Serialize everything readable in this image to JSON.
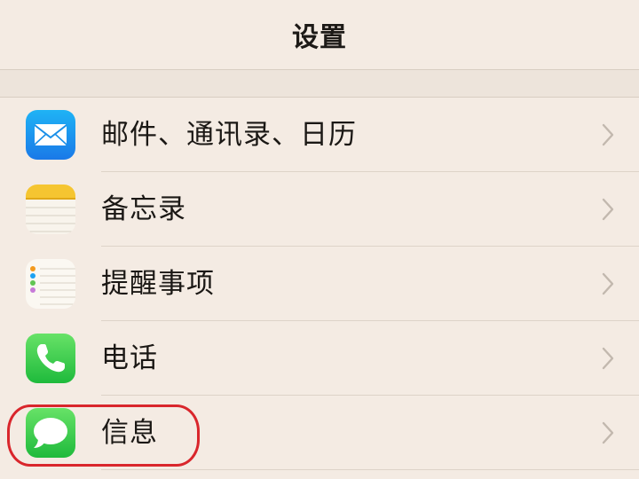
{
  "header": {
    "title": "设置"
  },
  "rows": [
    {
      "label": "邮件、通讯录、日历",
      "icon": "mail-icon"
    },
    {
      "label": "备忘录",
      "icon": "notes-icon"
    },
    {
      "label": "提醒事项",
      "icon": "reminders-icon"
    },
    {
      "label": "电话",
      "icon": "phone-icon"
    },
    {
      "label": "信息",
      "icon": "messages-icon"
    }
  ],
  "colors": {
    "background": "#f4ebe3",
    "separator": "#ddd3c8",
    "chevron": "#c2b8ae",
    "highlight": "#d9262c"
  }
}
